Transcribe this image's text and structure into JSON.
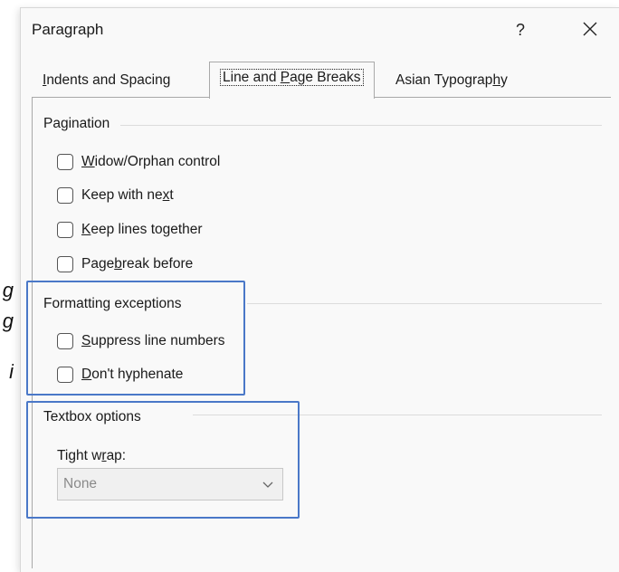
{
  "background_fragments": [
    "g",
    "g",
    "i"
  ],
  "dialog": {
    "title": "Paragraph",
    "help_label": "?",
    "close_icon": "close-icon"
  },
  "tabs": [
    {
      "pre": "",
      "u": "I",
      "post": "ndents and Spacing",
      "active": false
    },
    {
      "pre": "Line and ",
      "u": "P",
      "post": "age Breaks",
      "active": true
    },
    {
      "pre": "Asian Typograp",
      "u": "h",
      "post": "y",
      "active": false
    }
  ],
  "pagination": {
    "heading": "Pagination",
    "items": [
      {
        "pre": "",
        "u": "W",
        "post": "idow/Orphan control",
        "checked": false
      },
      {
        "pre": "Keep with ne",
        "u": "x",
        "post": "t",
        "checked": false
      },
      {
        "pre": "",
        "u": "K",
        "post": "eep lines together",
        "checked": false
      },
      {
        "pre": "Page ",
        "u": "b",
        "post": "reak before",
        "checked": false
      }
    ]
  },
  "formatting_exceptions": {
    "heading": "Formatting exceptions",
    "items": [
      {
        "pre": "",
        "u": "S",
        "post": "uppress line numbers",
        "checked": false
      },
      {
        "pre": "",
        "u": "D",
        "post": "on't hyphenate",
        "checked": false
      }
    ]
  },
  "textbox_options": {
    "heading": "Textbox options",
    "label_pre": "Tight w",
    "label_u": "r",
    "label_post": "ap:",
    "select_value": "None"
  },
  "colors": {
    "highlight": "#4a78c8",
    "dialog_bg": "#f9f9f9"
  }
}
